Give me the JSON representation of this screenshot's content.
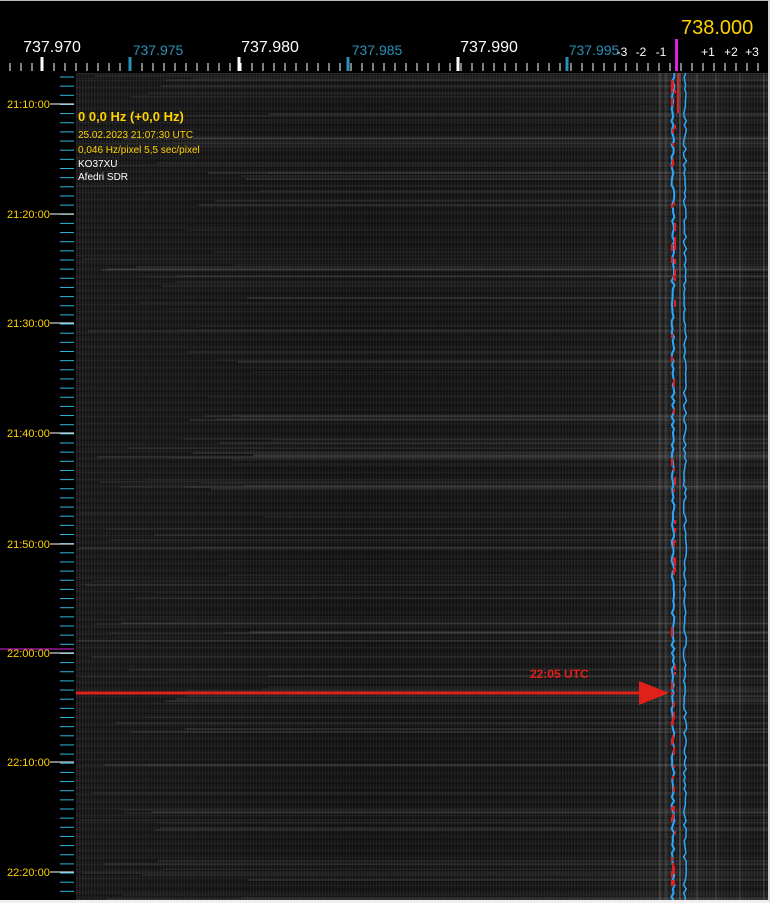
{
  "frequency_scale": {
    "major_labels": [
      "737.970",
      "737.980",
      "737.990"
    ],
    "minor_labels": [
      "737.975",
      "737.985",
      "737.995"
    ],
    "center_label": "738.000",
    "offset_labels_left": [
      "-3",
      "-2",
      "-1"
    ],
    "offset_labels_right": [
      "+1",
      "+2",
      "+3"
    ]
  },
  "time_scale": {
    "labels": [
      "21:10:00",
      "21:20:00",
      "21:30:00",
      "21:40:00",
      "21:50:00",
      "22:00:00",
      "22:10:00",
      "22:20:00"
    ]
  },
  "info_panel": {
    "title": "0 0,0 Hz (+0,0 Hz)",
    "datetime": "25.02.2023 21:07:30 UTC",
    "resolution": "0,046 Hz/pixel 5,5 sec/pixel",
    "callsign": "KO37XU",
    "receiver": "Afedri SDR"
  },
  "annotation": {
    "label": "22:05 UTC",
    "color": "#e0201a"
  },
  "colors": {
    "background": "#000000",
    "label_yellow": "#ffd200",
    "minor_label_blue": "#2a90b8",
    "marker_magenta": "#e020e0",
    "trace_blue": "#2aa8ff",
    "trace_red": "#e02020"
  }
}
